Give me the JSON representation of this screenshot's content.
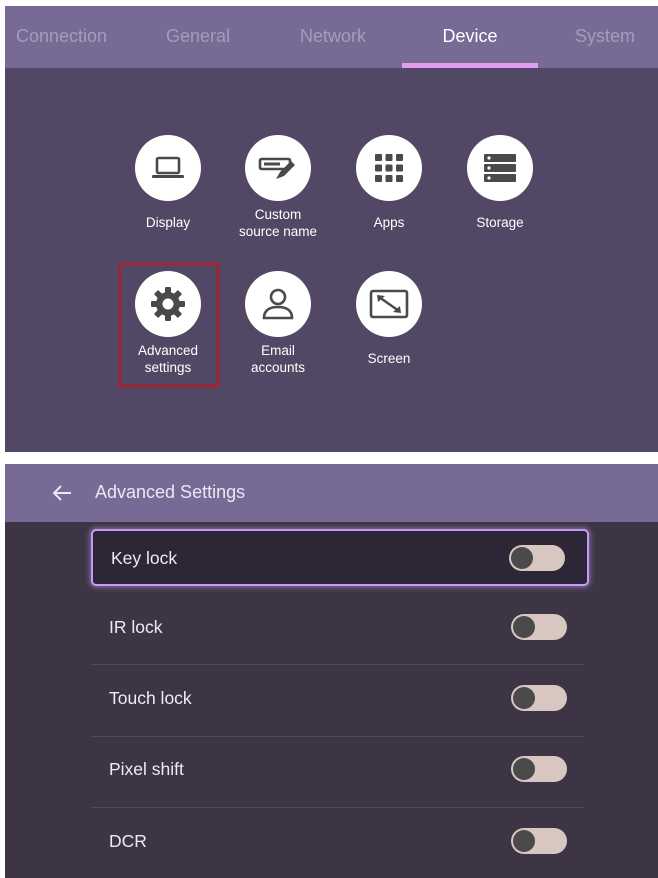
{
  "top": {
    "tabs": [
      {
        "label": "Connection"
      },
      {
        "label": "General"
      },
      {
        "label": "Network"
      },
      {
        "label": "Device",
        "active": true
      },
      {
        "label": "System"
      }
    ],
    "tiles": [
      {
        "label": "Display",
        "icon": "laptop-icon"
      },
      {
        "label_line1": "Custom",
        "label_line2": "source name",
        "icon": "keyboard-pen-icon"
      },
      {
        "label": "Apps",
        "icon": "apps-grid-icon"
      },
      {
        "label": "Storage",
        "icon": "storage-icon"
      },
      {
        "label_line1": "Advanced",
        "label_line2": "settings",
        "icon": "gear-icon",
        "highlighted": true
      },
      {
        "label_line1": "Email",
        "label_line2": "accounts",
        "icon": "person-icon"
      },
      {
        "label": "Screen",
        "icon": "screen-resize-icon"
      }
    ]
  },
  "bottom": {
    "title": "Advanced Settings",
    "back_icon": "arrow-left-icon",
    "items": [
      {
        "label": "Key lock",
        "focused": true,
        "on": false
      },
      {
        "label": "IR lock",
        "on": false
      },
      {
        "label": "Touch lock",
        "on": false
      },
      {
        "label": "Pixel shift",
        "on": false
      },
      {
        "label": "DCR",
        "on": false
      }
    ]
  },
  "colors": {
    "tab_bar": "#776a95",
    "top_background": "#524865",
    "bottom_background": "#3d3545",
    "active_underline": "#e39bf2",
    "highlight_box": "#c6141a",
    "focus_border": "#c49af4",
    "toggle_track": "#d8c7c1"
  }
}
